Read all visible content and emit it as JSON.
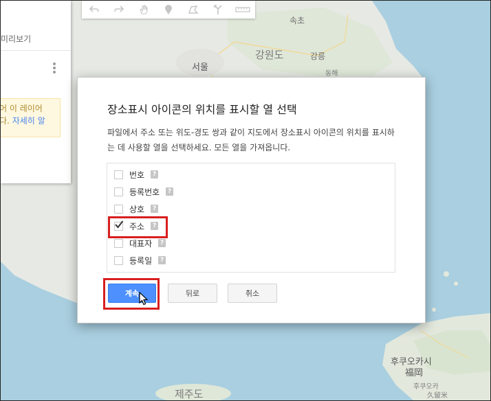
{
  "map": {
    "labels": {
      "sokcho": "속초",
      "gangwon": "강원도",
      "gangneung": "강릉",
      "seoul": "서울",
      "donghae": "동해",
      "fukuoka_kana": "후쿠오카시",
      "fukuoka_kanji": "福岡",
      "jeju": "제주도",
      "fukuoka_small1": "후쿠오카",
      "fukuoka_small2": "久留米"
    }
  },
  "left_panel": {
    "preview_label": "미리보기",
    "note_line1": "어 이 레이어",
    "note_line2_text": "다.",
    "note_link": "자세히 알"
  },
  "toolbar": {
    "icons": [
      "undo-icon",
      "redo-icon",
      "hand-icon",
      "marker-icon",
      "polygon-icon",
      "route-icon",
      "ruler-icon"
    ]
  },
  "dialog": {
    "title": "장소표시 아이콘의 위치를 표시할 열 선택",
    "description": "파일에서 주소 또는 위도-경도 쌍과 같이 지도에서 장소표시 아이콘의 위치를 표시하는 데 사용할 열을 선택하세요. 모든 열을 가져옵니다.",
    "columns": [
      {
        "label": "번호",
        "checked": false
      },
      {
        "label": "등록번호",
        "checked": false
      },
      {
        "label": "상호",
        "checked": false
      },
      {
        "label": "주소",
        "checked": true
      },
      {
        "label": "대표자",
        "checked": false
      },
      {
        "label": "등록일",
        "checked": false
      }
    ],
    "help_glyph": "?",
    "buttons": {
      "continue": "계속",
      "back": "뒤로",
      "cancel": "취소"
    }
  },
  "colors": {
    "primary_button": "#4d90fe",
    "highlight": "#d81e1e",
    "sea": "#a9cfe0",
    "land": "#e8eae6"
  }
}
